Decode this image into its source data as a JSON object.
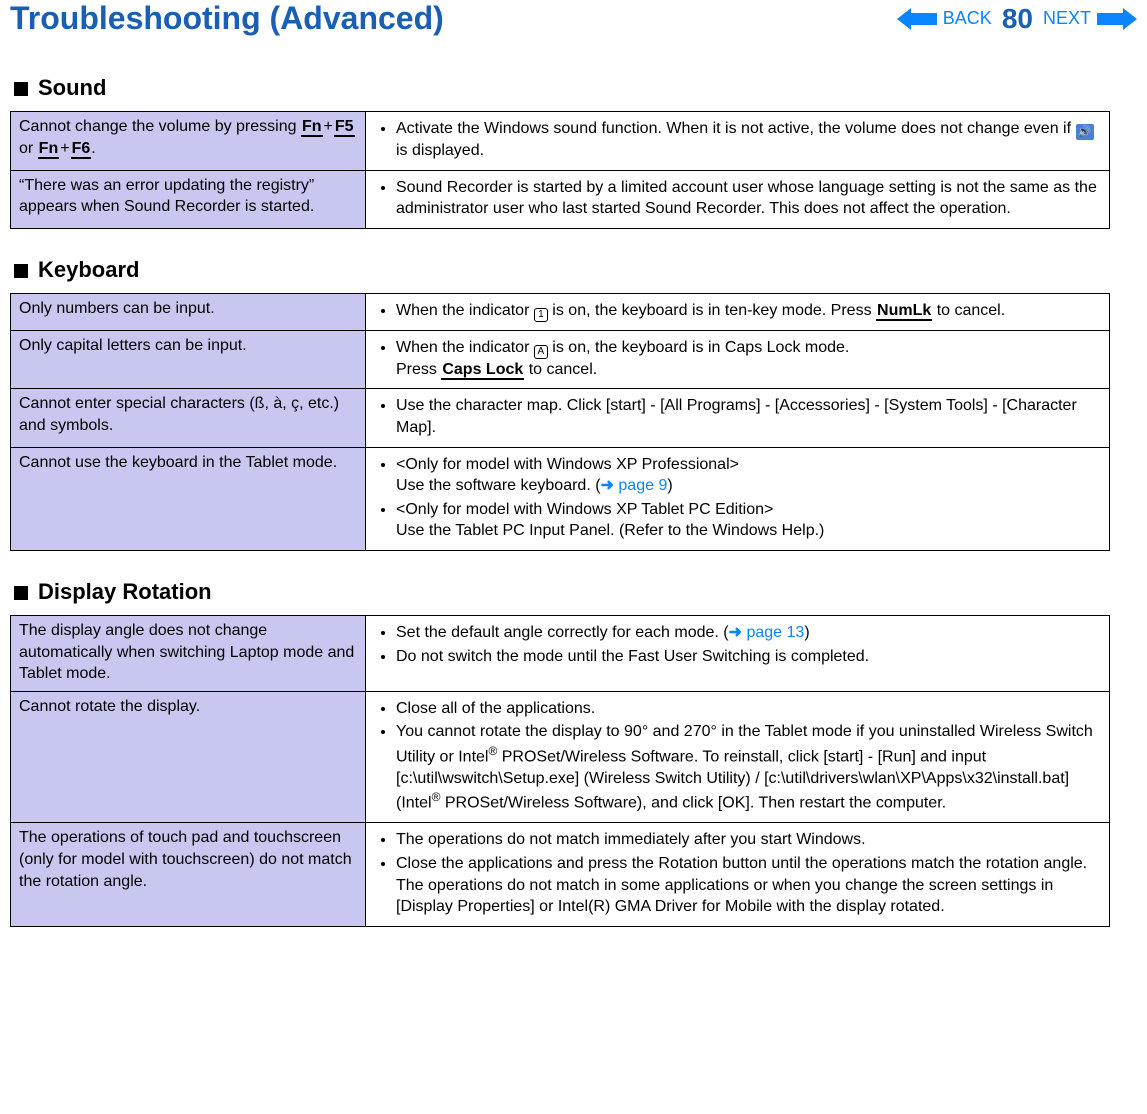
{
  "header": {
    "title": "Troubleshooting (Advanced)",
    "back": "BACK",
    "next": "NEXT",
    "page": "80"
  },
  "s_sound": "Sound",
  "s_keyboard": "Keyboard",
  "s_display": "Display Rotation",
  "sound_r1_p_a": "Cannot change the volume by pressing ",
  "sound_r1_p_fn1": "Fn",
  "sound_r1_p_plus": "+",
  "sound_r1_p_f5": "F5",
  "sound_r1_p_or": " or ",
  "sound_r1_p_fn2": "Fn",
  "sound_r1_p_f6": "F6",
  "sound_r1_p_end": ".",
  "sound_r1_s_a": "Activate the Windows sound function. When it is not active, the volume does not change even if ",
  "sound_r1_s_b": " is displayed.",
  "sound_r2_p": "“There was an error updating the registry” appears when Sound Recorder is started.",
  "sound_r2_s": "Sound Recorder is started by a limited account user whose language setting is not the same as the administrator user who last started Sound Recorder. This does not affect the operation.",
  "kb_r1_p": "Only numbers can be input.",
  "kb_r1_s_a": "When the indicator ",
  "kb_r1_s_b": " is on, the keyboard is in ten-key mode. Press ",
  "kb_r1_s_numlk": "NumLk",
  "kb_r1_s_c": " to cancel.",
  "kb_r2_p": "Only capital letters can be input.",
  "kb_r2_s_a": "When the indicator ",
  "kb_r2_s_b": " is on, the keyboard is in Caps Lock mode.",
  "kb_r2_s_c": "Press ",
  "kb_r2_s_caps": "Caps Lock",
  "kb_r2_s_d": " to cancel.",
  "kb_r3_p": "Cannot enter special characters (ß, à, ç, etc.) and symbols.",
  "kb_r3_s": "Use the character map. Click [start] - [All Programs] - [Accessories] - [System Tools] - [Character Map].",
  "kb_r4_p": "Cannot use the keyboard in the Tablet mode.",
  "kb_r4_s1a": "<Only for model with Windows XP Professional>",
  "kb_r4_s1b": "Use the software keyboard. (",
  "kb_r4_s1arrow": "➜",
  "kb_r4_s1link": " page 9",
  "kb_r4_s1c": ")",
  "kb_r4_s2a": "<Only for model with Windows XP Tablet PC Edition>",
  "kb_r4_s2b": "Use the Tablet PC Input Panel. (Refer to the Windows Help.)",
  "dr_r1_p": "The display angle does not change automatically when switching Laptop mode and Tablet mode.",
  "dr_r1_s1a": "Set the default angle correctly for each mode. (",
  "dr_r1_s1arrow": "➜",
  "dr_r1_s1link": " page 13",
  "dr_r1_s1b": ")",
  "dr_r1_s2": "Do not switch the mode until the Fast User Switching is completed.",
  "dr_r2_p": "Cannot rotate the display.",
  "dr_r2_s1": "Close all of the applications.",
  "dr_r2_s2a": "You cannot rotate the display to 90° and 270° in the Tablet mode if you uninstalled Wireless Switch Utility or Intel",
  "dr_r2_s2reg": "®",
  "dr_r2_s2b": " PROSet/Wireless Software. To reinstall, click [start] - [Run] and input [c:\\util\\wswitch\\Setup.exe] (Wireless Switch Utility) / [c:\\util\\drivers\\wlan\\XP\\Apps\\x32\\install.bat] (Intel",
  "dr_r2_s2c": " PROSet/Wireless Software), and click [OK]. Then restart the computer.",
  "dr_r3_p": "The operations of touch pad and touchscreen (only for model with touchscreen) do not match the rotation angle.",
  "dr_r3_s1": "The operations do not match immediately after you start Windows.",
  "dr_r3_s2": "Close the applications and press the Rotation button until the operations match the rotation angle. The operations do not match in some applications or when you change the screen settings in [Display Properties] or Intel(R) GMA Driver for Mobile with the display rotated.",
  "ind1": "1",
  "indA": "A"
}
